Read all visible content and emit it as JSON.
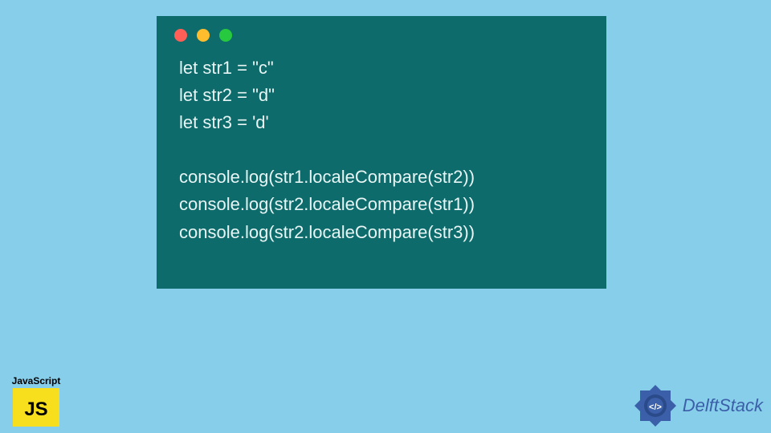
{
  "code": {
    "lines": [
      "let str1 = \"c\"",
      "let str2 = \"d\"",
      "let str3 = 'd'",
      "",
      "console.log(str1.localeCompare(str2))",
      "console.log(str2.localeCompare(str1))",
      "console.log(str2.localeCompare(str3))"
    ]
  },
  "js_badge": {
    "label": "JavaScript",
    "logo_text": "JS"
  },
  "brand": {
    "name": "DelftStack"
  }
}
